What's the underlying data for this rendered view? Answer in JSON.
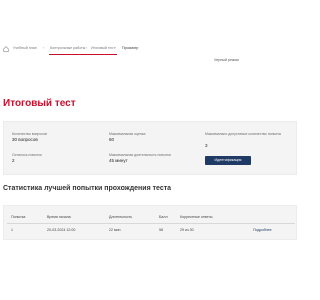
{
  "breadcrumb": {
    "items": [
      "Учебный план",
      "Контрольные работы",
      "Итоговый тест"
    ],
    "current": "Просмотр"
  },
  "user_menu": "Черный режим",
  "page_title": "Итоговый тест",
  "info": {
    "questions_label": "Количество вопросов",
    "questions_value": "30 вопросов",
    "max_score_label": "Максимальная оценка",
    "max_score_value": "60",
    "max_attempts_label": "Максимально допустимое количество попыток",
    "max_attempts_value": "3",
    "remaining_label": "Осталось попыток",
    "remaining_value": "2",
    "max_duration_label": "Максимальная длительность попытки",
    "max_duration_value": "45 минут",
    "identify_button": "Идентификация"
  },
  "stats": {
    "title": "Статистика лучшей попытки прохождения теста",
    "columns": [
      "Попытка",
      "Время начала",
      "Длительность",
      "Балл",
      "Корректные ответы",
      ""
    ],
    "row": {
      "attempt": "1",
      "start": "20-03-2024 12:00",
      "duration": "22 мин",
      "score": "58",
      "correct": "29 из 30",
      "details": "Подробнее"
    }
  },
  "colors": {
    "accent": "#c8102e",
    "button": "#1f3a64"
  }
}
